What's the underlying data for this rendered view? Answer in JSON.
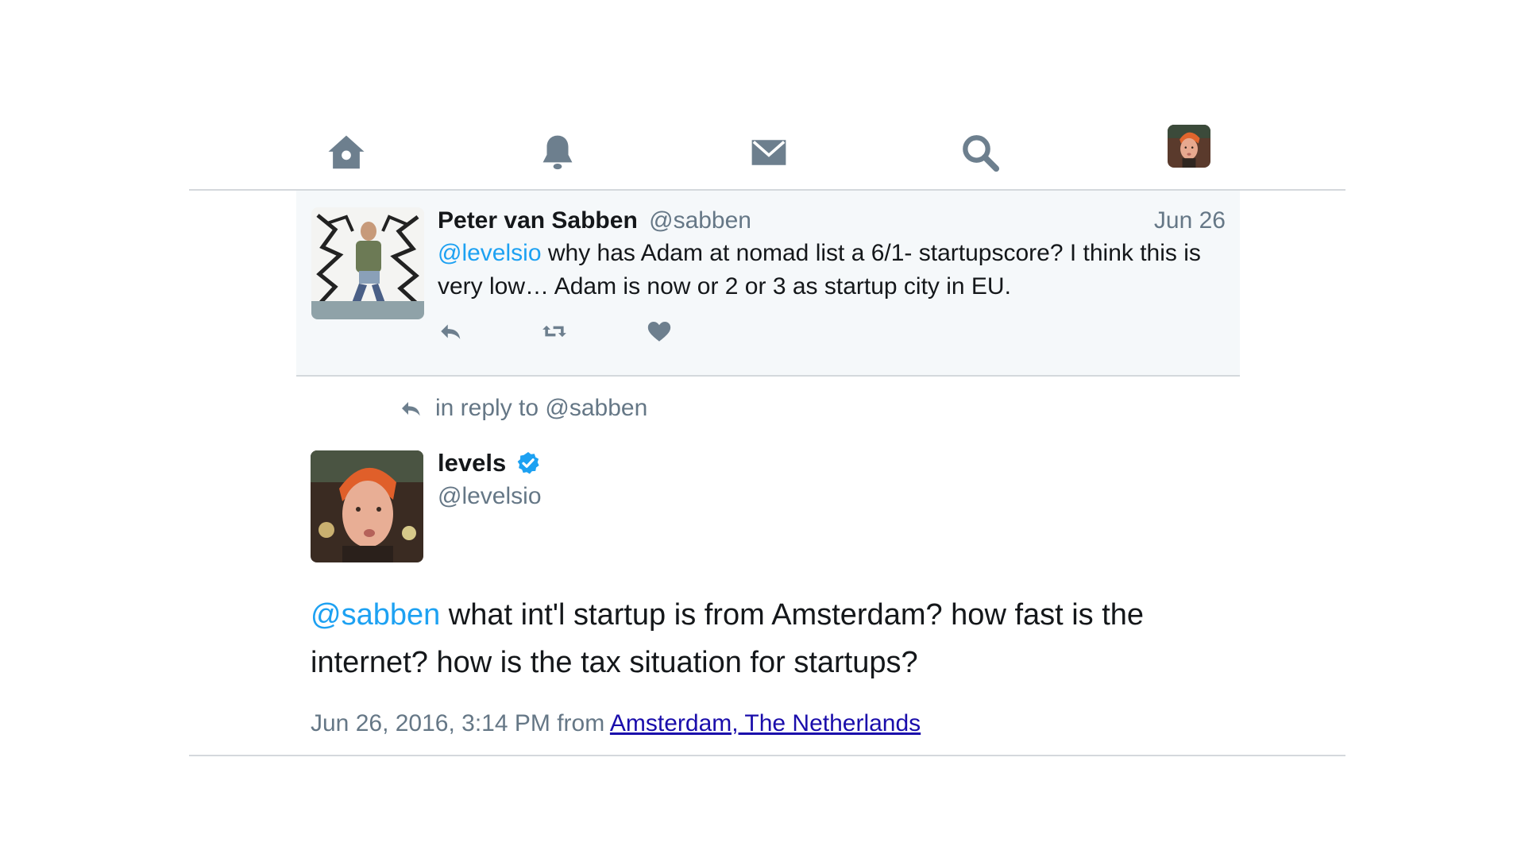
{
  "nav": {
    "icons": [
      "home-icon",
      "notifications-icon",
      "messages-icon",
      "search-icon",
      "profile-avatar"
    ]
  },
  "parent_tweet": {
    "name": "Peter van Sabben",
    "handle": "@sabben",
    "date": "Jun 26",
    "mention": "@levelsio",
    "text": " why has Adam at nomad list a 6/1- startupscore? I think this is very low… Adam is now or 2 or 3 as startup city in EU."
  },
  "reply_to": {
    "label": "in reply to @sabben"
  },
  "main_tweet": {
    "name": "levels",
    "handle": "@levelsio",
    "mention": "@sabben",
    "text": " what int'l startup is from Amsterdam? how fast is the internet? how is the tax situation for startups?",
    "timestamp": "Jun 26, 2016, 3:14 PM from ",
    "location": "Amsterdam, The Netherlands"
  },
  "colors": {
    "icon": "#6d7f8e",
    "mention": "#1da1f2",
    "link": "#1a0dab",
    "verified": "#1da1f2"
  }
}
